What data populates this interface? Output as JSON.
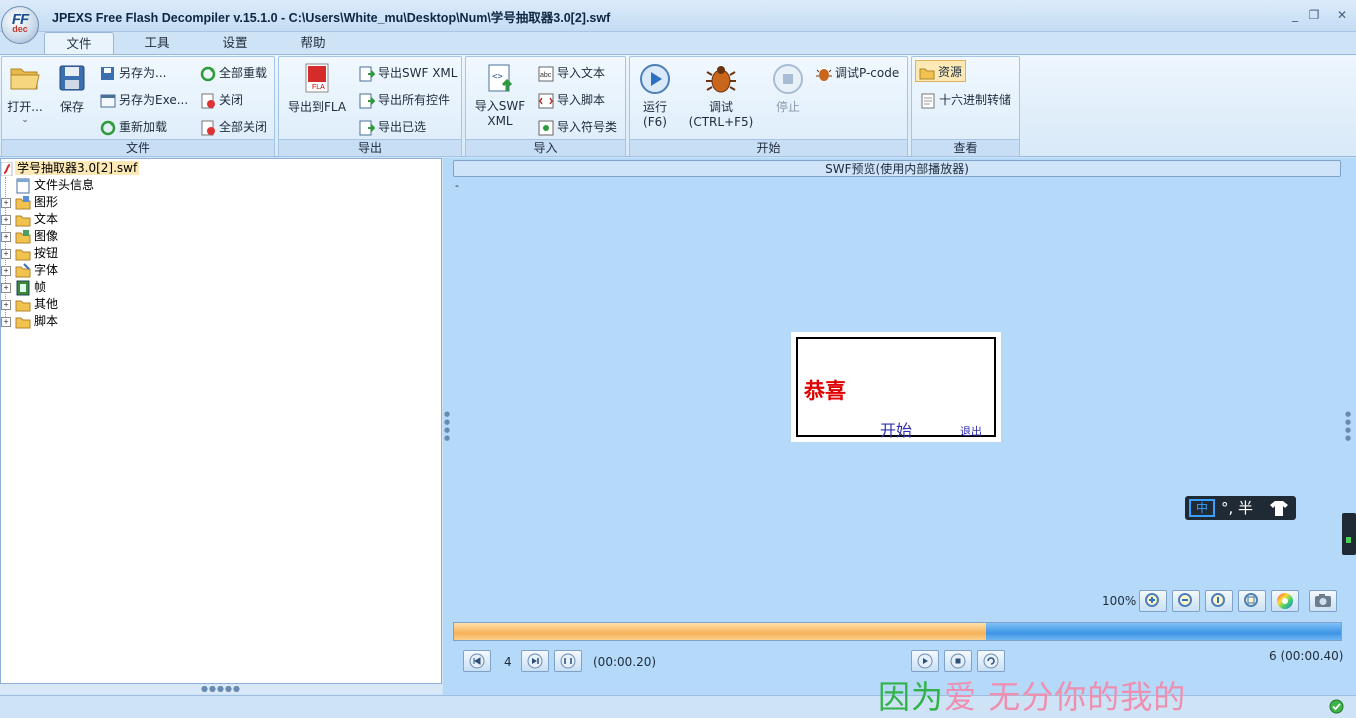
{
  "window": {
    "title": "JPEXS Free Flash Decompiler v.15.1.0 - C:\\Users\\White_mu\\Desktop\\Num\\学号抽取器3.0[2].swf",
    "logo_text": "FF",
    "logo_sub": "dec"
  },
  "tabs": [
    {
      "label": "文件",
      "active": true
    },
    {
      "label": "工具"
    },
    {
      "label": "设置"
    },
    {
      "label": "帮助"
    }
  ],
  "ribbon": {
    "file": {
      "label": "文件",
      "open": "打开...",
      "save": "保存",
      "save_as": "另存为...",
      "save_as_exe": "另存为Exe...",
      "reload": "重新加载",
      "reload_all": "全部重载",
      "close": "关闭",
      "close_all": "全部关闭"
    },
    "export": {
      "label": "导出",
      "export_fla": "导出到FLA",
      "export_swf_xml": "导出SWF XML",
      "export_all": "导出所有控件",
      "export_selected": "导出已选"
    },
    "import": {
      "label": "导入",
      "import_swf_xml_1": "导入SWF",
      "import_swf_xml_2": "XML",
      "import_text": "导入文本",
      "import_script": "导入脚本",
      "import_symbol": "导入符号类"
    },
    "start": {
      "label": "开始",
      "run_1": "运行",
      "run_2": "(F6)",
      "debug_1": "调试",
      "debug_2": "(CTRL+F5)",
      "stop": "停止",
      "debug_pcode": "调试P-code"
    },
    "view": {
      "label": "查看",
      "resources": "资源",
      "hex_dump": "十六进制转储"
    }
  },
  "tree": {
    "root": "学号抽取器3.0[2].swf",
    "items": [
      {
        "label": "文件头信息",
        "expandable": false
      },
      {
        "label": "图形",
        "expandable": true
      },
      {
        "label": "文本",
        "expandable": true
      },
      {
        "label": "图像",
        "expandable": true
      },
      {
        "label": "按钮",
        "expandable": true
      },
      {
        "label": "字体",
        "expandable": true
      },
      {
        "label": "帧",
        "expandable": true
      },
      {
        "label": "其他",
        "expandable": true
      },
      {
        "label": "脚本",
        "expandable": true
      }
    ]
  },
  "preview": {
    "header": "SWF预览(使用内部播放器)",
    "dash": "-",
    "stage": {
      "title": "恭喜",
      "start_button": "开始",
      "exit_button": "退出"
    },
    "zoom_level": "100%",
    "current_frame": "4",
    "current_time": "(00:00.20)",
    "total": "6 (00:00.40)",
    "progress": 0.6
  },
  "ime": {
    "symbols": "°, 半"
  },
  "watermark": {
    "green": "因为",
    "pink": "爱 无分你的我的"
  },
  "colors": {
    "accent": "#3d95e6",
    "progress_fill": "#f6b25b",
    "stage_title": "#e00000",
    "stage_buttons": "#3030b0"
  }
}
